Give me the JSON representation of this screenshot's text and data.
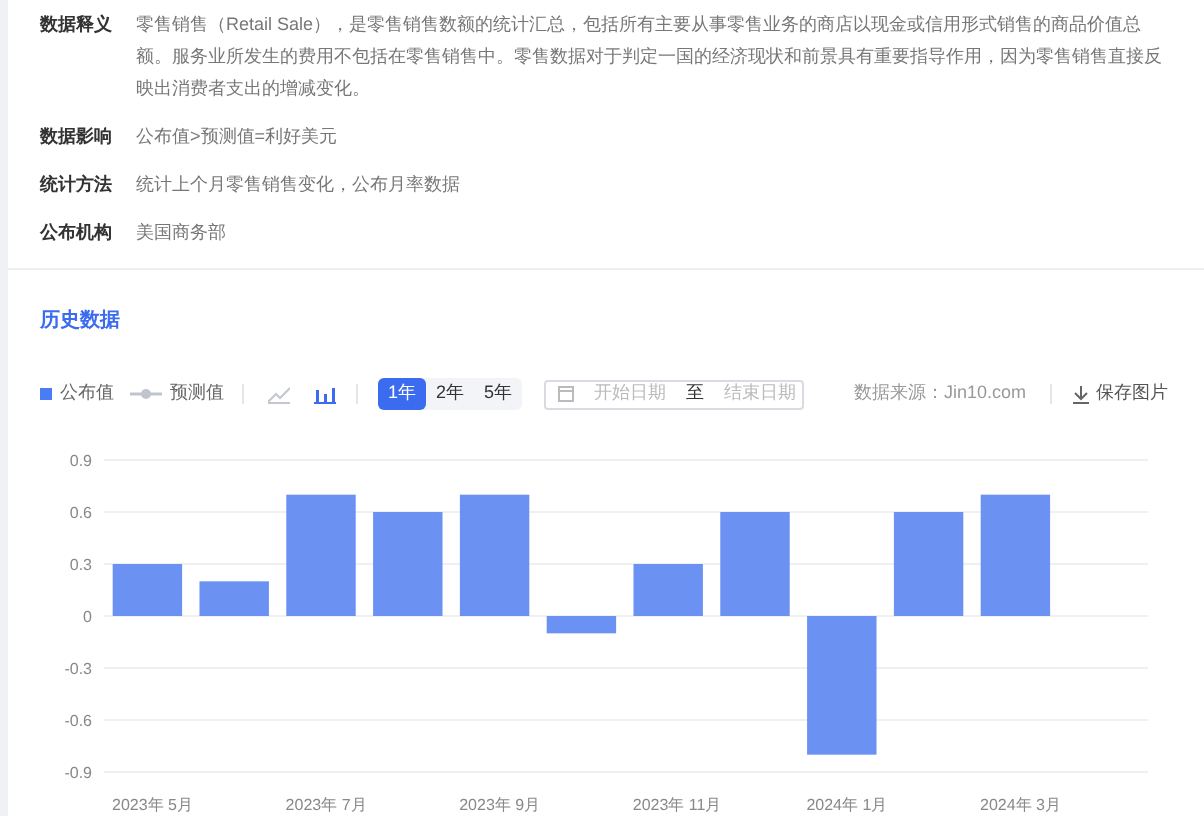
{
  "info_rows": [
    {
      "label": "数据释义",
      "text": "零售销售（Retail Sale），是零售销售数额的统计汇总，包括所有主要从事零售业务的商店以现金或信用形式销售的商品价值总额。服务业所发生的费用不包括在零售销售中。零售数据对于判定一国的经济现状和前景具有重要指导作用，因为零售销售直接反映出消费者支出的增减变化。"
    },
    {
      "label": "数据影响",
      "text": "公布值>预测值=利好美元"
    },
    {
      "label": "统计方法",
      "text": "统计上个月零售销售变化，公布月率数据"
    },
    {
      "label": "公布机构",
      "text": "美国商务部"
    }
  ],
  "section_title": "历史数据",
  "legend": [
    {
      "kind": "square",
      "color": "#4a7cf6"
    },
    {
      "kind": "line",
      "label": "预测值",
      "color": "#bfc4cf"
    }
  ],
  "chart_types": [
    {
      "kind": "line",
      "selected": false
    },
    {
      "kind": "bar",
      "selected": true
    }
  ],
  "ranges": [
    {
      "label": "1年",
      "selected": true
    },
    {
      "label": "2年",
      "selected": false
    },
    {
      "label": "5年",
      "selected": false
    }
  ],
  "date_range": {
    "start_placeholder": "开始日期",
    "separator": "至",
    "end_placeholder": "结束日期"
  },
  "source": "数据来源：Jin10.com",
  "save_button": "保存图片",
  "chart_data": {
    "type": "bar",
    "grid": true,
    "categories": [
      "2023年 5月",
      null,
      "2023年 7月",
      null,
      "2023年 9月",
      null,
      "2023年 11月",
      null,
      "2024年 1月",
      null,
      "2024年 3月"
    ],
    "series": [
      {
        "name": "公布值",
        "color": "#6b91f3",
        "values": [
          0.3,
          0.2,
          0.7,
          0.6,
          0.7,
          -0.1,
          0.3,
          0.6,
          -0.8,
          0.6,
          0.7
        ]
      }
    ],
    "ylim": [
      -0.9,
      0.9
    ],
    "yticks": [
      {
        "value": 0.9,
        "label": "0.9"
      },
      {
        "value": 0.6,
        "label": "0.6"
      },
      {
        "value": 0.3,
        "label": "0.3"
      },
      {
        "value": 0,
        "label": "0"
      },
      {
        "value": -0.3,
        "label": "-0.3"
      },
      {
        "value": -0.6,
        "label": "-0.6"
      },
      {
        "value": -0.9,
        "label": "-0.9"
      }
    ]
  }
}
